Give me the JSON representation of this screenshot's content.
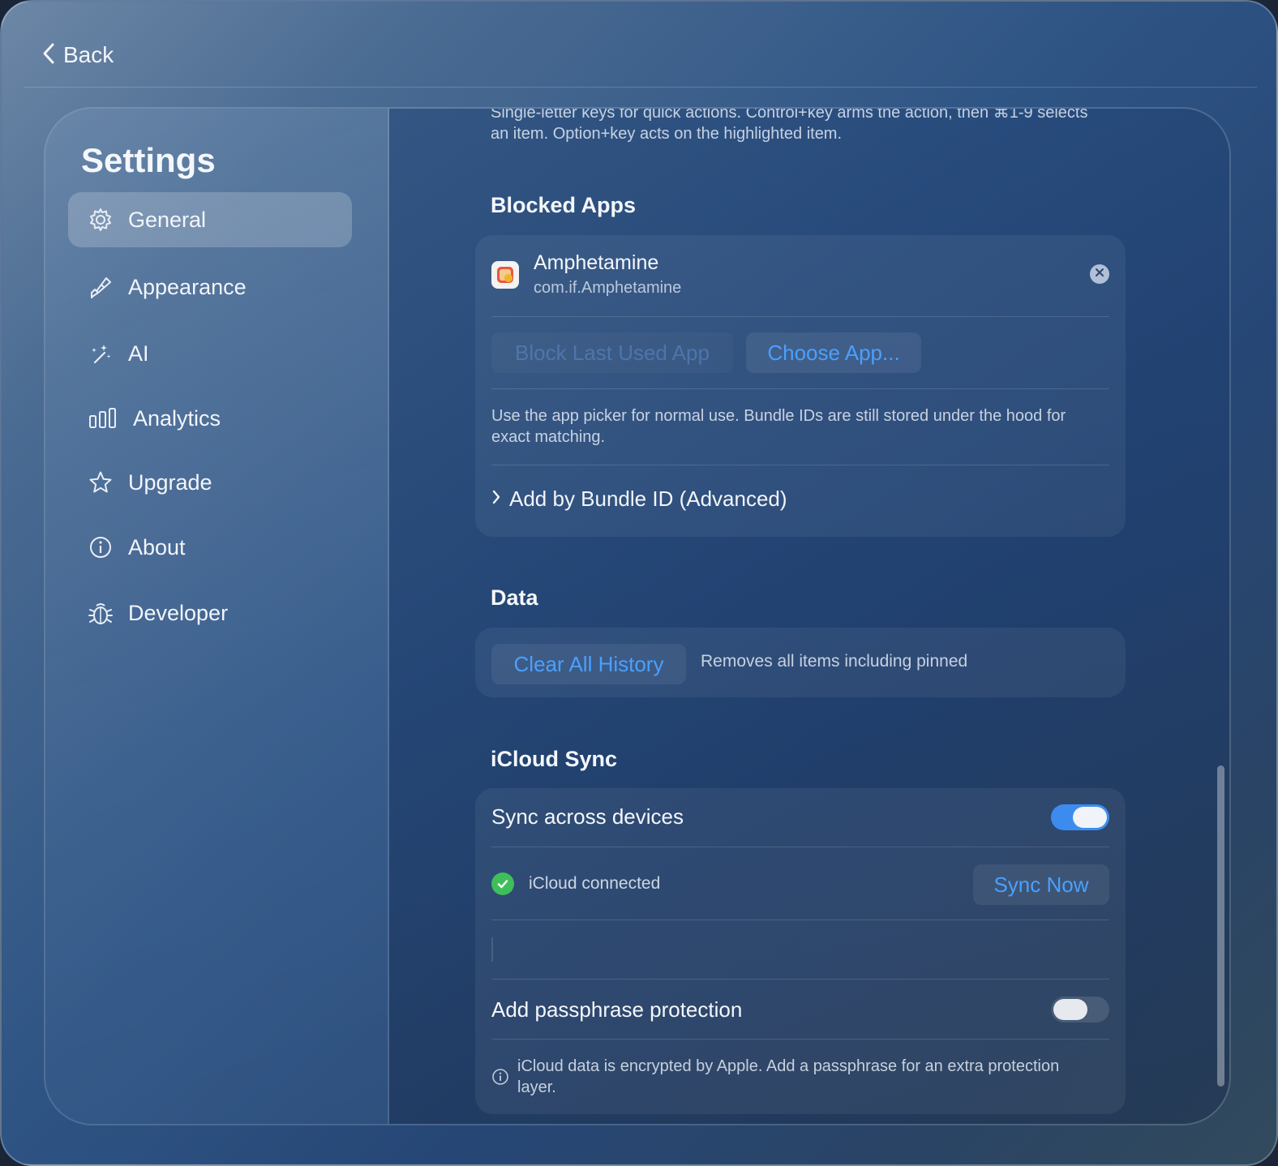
{
  "topbar": {
    "back_label": "Back"
  },
  "sidebar": {
    "title": "Settings",
    "items": [
      {
        "label": "General",
        "icon": "gear-icon",
        "active": true
      },
      {
        "label": "Appearance",
        "icon": "paintbrush-icon"
      },
      {
        "label": "AI",
        "icon": "sparkles-wand-icon"
      },
      {
        "label": "Analytics",
        "icon": "bar-chart-icon"
      },
      {
        "label": "Upgrade",
        "icon": "star-icon"
      },
      {
        "label": "About",
        "icon": "info-icon"
      },
      {
        "label": "Developer",
        "icon": "bug-icon"
      }
    ]
  },
  "content": {
    "intro_text": "Single-letter keys for quick actions. Control+key arms the action, then ⌘1-9 selects an item. Option+key acts on the highlighted item.",
    "blocked_apps": {
      "title": "Blocked Apps",
      "app_name": "Amphetamine",
      "app_bundle": "com.if.Amphetamine",
      "block_last_label": "Block Last Used App",
      "choose_app_label": "Choose App...",
      "help_text": "Use the app picker for normal use. Bundle IDs are still stored under the hood for exact matching.",
      "advanced_label": "Add by Bundle ID (Advanced)"
    },
    "data": {
      "title": "Data",
      "clear_label": "Clear All History",
      "clear_desc": "Removes all items including pinned"
    },
    "icloud": {
      "title": "iCloud Sync",
      "sync_label": "Sync across devices",
      "sync_enabled": true,
      "status_text": "iCloud connected",
      "sync_now_label": "Sync Now",
      "passphrase_label": "Add passphrase protection",
      "passphrase_enabled": false,
      "info_text": "iCloud data is encrypted by Apple. Add a passphrase for an extra protection layer."
    }
  },
  "colors": {
    "accent": "#3c8cf0",
    "link": "#4aa0ff",
    "success": "#3fbf5a"
  }
}
